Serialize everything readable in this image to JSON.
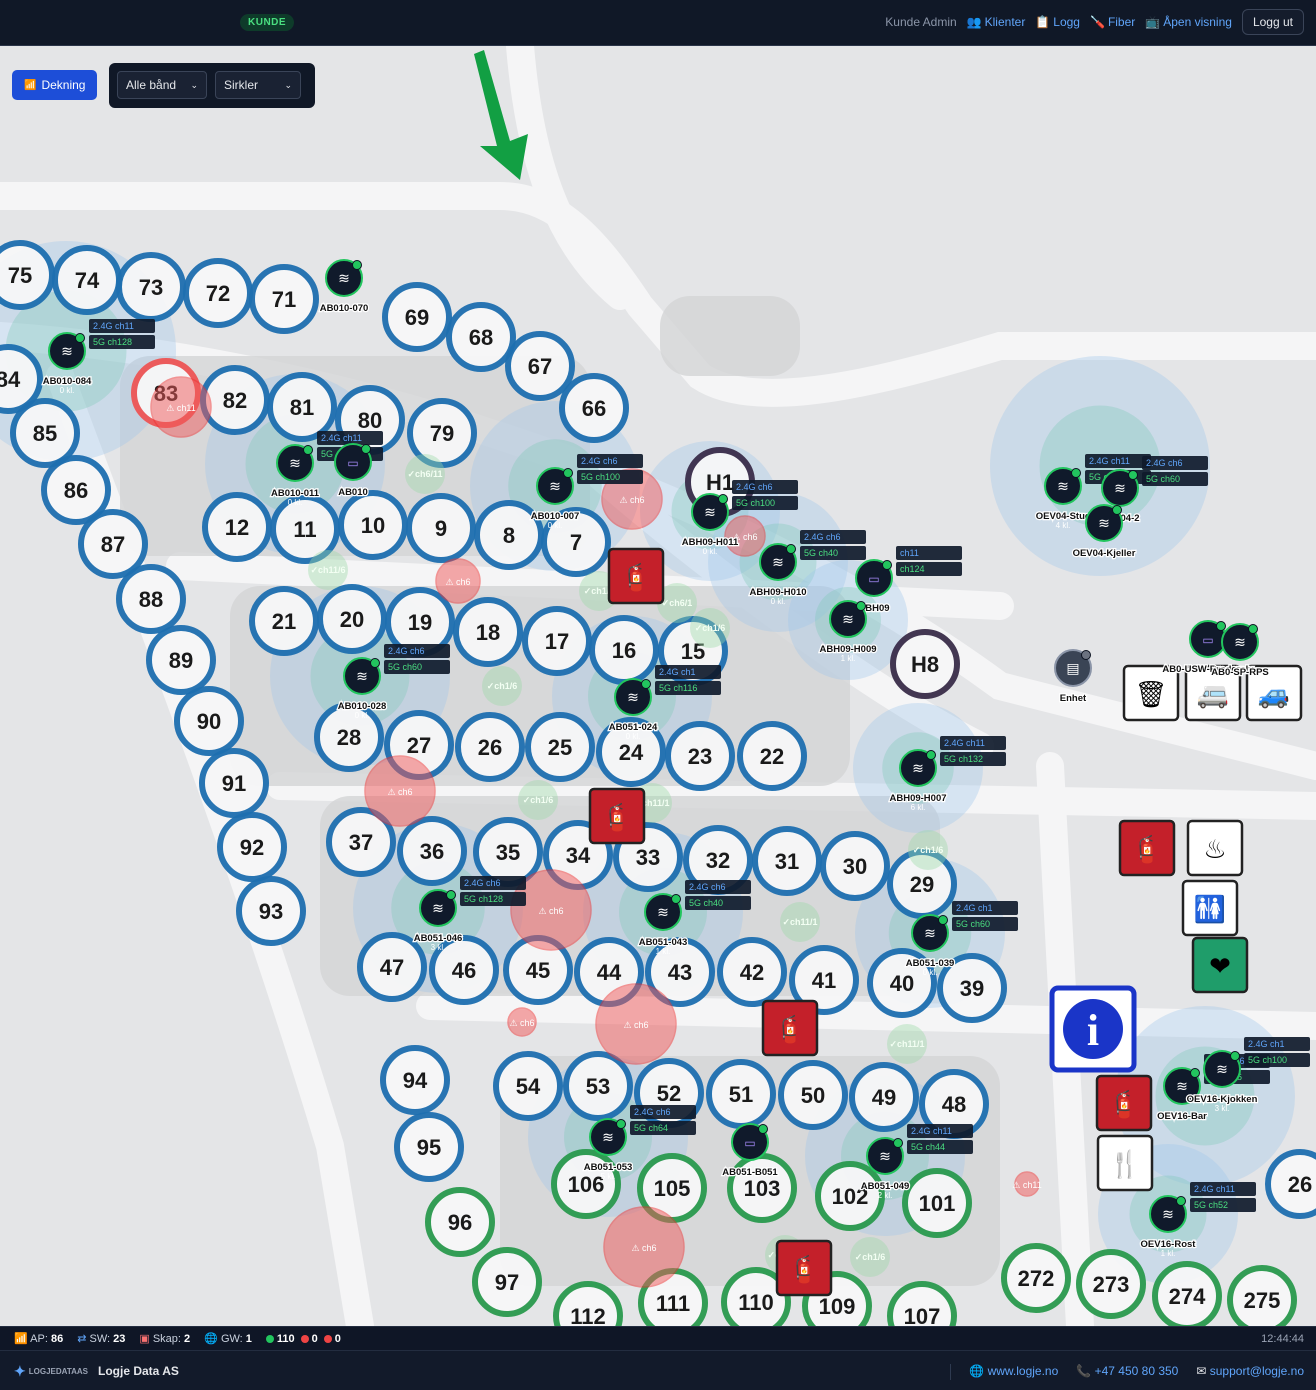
{
  "header": {
    "role_badge": "KUNDE",
    "user": "Kunde Admin",
    "nav": [
      "Klienter",
      "Logg",
      "Fiber",
      "Åpen visning"
    ],
    "logout": "Logg ut"
  },
  "controls": {
    "coverage_button": "Dekning",
    "band_select": "Alle bånd",
    "style_select": "Sirkler"
  },
  "map": {
    "sites": [
      "75",
      "74",
      "73",
      "72",
      "71",
      "69",
      "68",
      "67",
      "66",
      "84",
      "83",
      "82",
      "81",
      "80",
      "79",
      "85",
      "86",
      "87",
      "88",
      "89",
      "90",
      "91",
      "92",
      "93",
      "12",
      "11",
      "10",
      "9",
      "8",
      "7",
      "21",
      "20",
      "19",
      "18",
      "17",
      "16",
      "15",
      "28",
      "27",
      "26",
      "25",
      "24",
      "23",
      "22",
      "37",
      "36",
      "35",
      "34",
      "33",
      "32",
      "31",
      "30",
      "29",
      "47",
      "46",
      "45",
      "44",
      "43",
      "42",
      "41",
      "40",
      "39",
      "94",
      "95",
      "54",
      "53",
      "52",
      "51",
      "50",
      "49",
      "48",
      "96",
      "97",
      "106",
      "105",
      "103",
      "102",
      "101",
      "112",
      "111",
      "110",
      "109",
      "107",
      "272",
      "273",
      "274",
      "275",
      "H8",
      "H1",
      "26"
    ],
    "access_points": [
      {
        "name": "AB010-070",
        "tags": [],
        "clients": ""
      },
      {
        "name": "AB010-084",
        "tags": [
          "2.4G ch11",
          "5G ch128"
        ],
        "clients": "0 kl."
      },
      {
        "name": "AB010-011",
        "tags": [
          "2.4G ch11",
          "5G"
        ],
        "clients": "0 kl."
      },
      {
        "name": "AB010",
        "tags": [],
        "clients": ""
      },
      {
        "name": "AB010-007",
        "tags": [
          "2.4G ch6",
          "5G ch100"
        ],
        "clients": "0 kl."
      },
      {
        "name": "ABH09-H011",
        "tags": [
          "2.4G ch6",
          "5G ch100"
        ],
        "clients": "0 kl."
      },
      {
        "name": "ABH09-H010",
        "tags": [
          "2.4G ch6",
          "5G ch40"
        ],
        "clients": "0 kl."
      },
      {
        "name": "ABH09",
        "tags": [
          "ch11",
          "ch124"
        ],
        "clients": ""
      },
      {
        "name": "ABH09-H009",
        "tags": [],
        "clients": "1 kl."
      },
      {
        "name": "AB010-028",
        "tags": [
          "2.4G ch6",
          "5G ch60"
        ],
        "clients": "0 kl."
      },
      {
        "name": "AB051-024",
        "tags": [
          "2.4G ch1",
          "5G ch116"
        ],
        "clients": "0 kl."
      },
      {
        "name": "ABH09-H007",
        "tags": [
          "2.4G ch11",
          "5G ch132"
        ],
        "clients": "6 kl."
      },
      {
        "name": "AB051-046",
        "tags": [
          "2.4G ch6",
          "5G ch128"
        ],
        "clients": "3 kl."
      },
      {
        "name": "AB051-043",
        "tags": [
          "2.4G ch6",
          "5G ch40"
        ],
        "clients": "1 kl."
      },
      {
        "name": "AB051-039",
        "tags": [
          "2.4G ch1",
          "5G ch60"
        ],
        "clients": "0 kl."
      },
      {
        "name": "AB051-053",
        "tags": [
          "2.4G ch6",
          "5G ch64"
        ],
        "clients": "5 kl."
      },
      {
        "name": "AB051-B051",
        "tags": [],
        "clients": ""
      },
      {
        "name": "AB051-049",
        "tags": [
          "2.4G ch11",
          "5G ch44"
        ],
        "clients": "2 kl."
      },
      {
        "name": "OEV04-Stue",
        "tags": [
          "2.4G ch11",
          "5G ch40"
        ],
        "clients": "4 kl."
      },
      {
        "name": "OEV04-2",
        "tags": [
          "2.4G ch6",
          "5G ch60"
        ],
        "clients": ""
      },
      {
        "name": "OEV04-Kjeller",
        "tags": [],
        "clients": ""
      },
      {
        "name": "AB0-USW-Proderelv",
        "tags": [],
        "clients": ""
      },
      {
        "name": "AB0-SP-RPS",
        "tags": [],
        "clients": ""
      },
      {
        "name": "Enhet",
        "tags": [],
        "clients": ""
      },
      {
        "name": "OEV16-Bar",
        "tags": [
          "2.4G ch6",
          "5G ch36"
        ],
        "clients": ""
      },
      {
        "name": "OEV16-Kjokken",
        "tags": [
          "2.4G ch1",
          "5G ch100"
        ],
        "clients": "3 kl."
      },
      {
        "name": "OEV16-Rost",
        "tags": [
          "2.4G ch11",
          "5G ch52"
        ],
        "clients": "1 kl."
      }
    ],
    "conflicts": [
      "ch11",
      "ch6",
      "ch6",
      "ch6",
      "ch6",
      "ch6",
      "ch6",
      "ch6",
      "ch6",
      "ch11"
    ],
    "ok_labels": [
      "ch6/11",
      "ch11/6",
      "ch1/6",
      "ch6/1",
      "ch1/6",
      "ch1/6",
      "ch1/6",
      "ch11/1",
      "ch1/6",
      "ch11/1",
      "ch11/1",
      "ch11/1",
      "ch1/6"
    ]
  },
  "status": {
    "ap_label": "AP:",
    "ap_count": "86",
    "sw_label": "SW:",
    "sw_count": "23",
    "cabinet_label": "Skap:",
    "cabinet_count": "2",
    "gw_label": "GW:",
    "gw_count": "1",
    "online": "110",
    "warning": "0",
    "offline": "0",
    "clock": "12:44:44"
  },
  "footer": {
    "logo_text": "LOGJEDATAAS",
    "company": "Logje Data AS",
    "website": "www.logje.no",
    "phone": "+47 450 80 350",
    "email": "support@logje.no"
  },
  "colors": {
    "accent": "#1d4ed8",
    "online": "#22c55e",
    "offline": "#ef4444",
    "warning": "#ef4444"
  }
}
